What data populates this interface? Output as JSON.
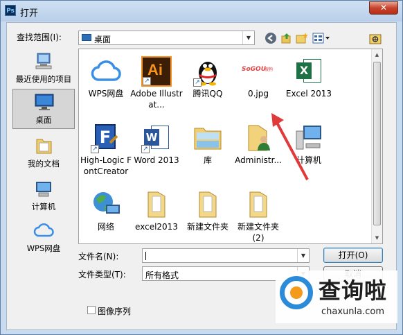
{
  "window": {
    "title": "打开",
    "app_icon_text": "Ps",
    "close_glyph": "✕"
  },
  "lookin": {
    "label": "查找范围(I):",
    "value": "桌面"
  },
  "places": [
    {
      "label": "最近使用的项目"
    },
    {
      "label": "桌面"
    },
    {
      "label": "我的文档"
    },
    {
      "label": "计算机"
    },
    {
      "label": "WPS网盘"
    }
  ],
  "files": [
    {
      "name": "WPS网盘"
    },
    {
      "name": "Adobe Illustrat..."
    },
    {
      "name": "腾讯QQ"
    },
    {
      "name": "0.jpg"
    },
    {
      "name": "Excel 2013"
    },
    {
      "name": "High-Logic FontCreator"
    },
    {
      "name": "Word 2013"
    },
    {
      "name": "库"
    },
    {
      "name": "Administr..."
    },
    {
      "name": "计算机"
    },
    {
      "name": "网络"
    },
    {
      "name": "excel2013"
    },
    {
      "name": "新建文件夹"
    },
    {
      "name": "新建文件夹 (2)"
    }
  ],
  "icon_text": {
    "ai": "Ai",
    "excel": "X",
    "word": "W",
    "fontcreator": "F",
    "sogou": "SoGOU",
    "sogou_tag": "搜狗"
  },
  "filename": {
    "label": "文件名(N):",
    "value": ""
  },
  "filetype": {
    "label": "文件类型(T):",
    "value": "所有格式"
  },
  "buttons": {
    "open": "打开(O)",
    "cancel": "取消"
  },
  "image_sequence": {
    "label": "图像序列",
    "checked": false
  },
  "watermark": {
    "brand": "查询啦",
    "url": "chaxunla.com"
  },
  "colors": {
    "accent_blue": "#2b8bd8",
    "arrow_red": "#e03a3a",
    "excel_green": "#1e7145",
    "word_blue": "#2b579a",
    "ai_orange": "#f7931e"
  }
}
